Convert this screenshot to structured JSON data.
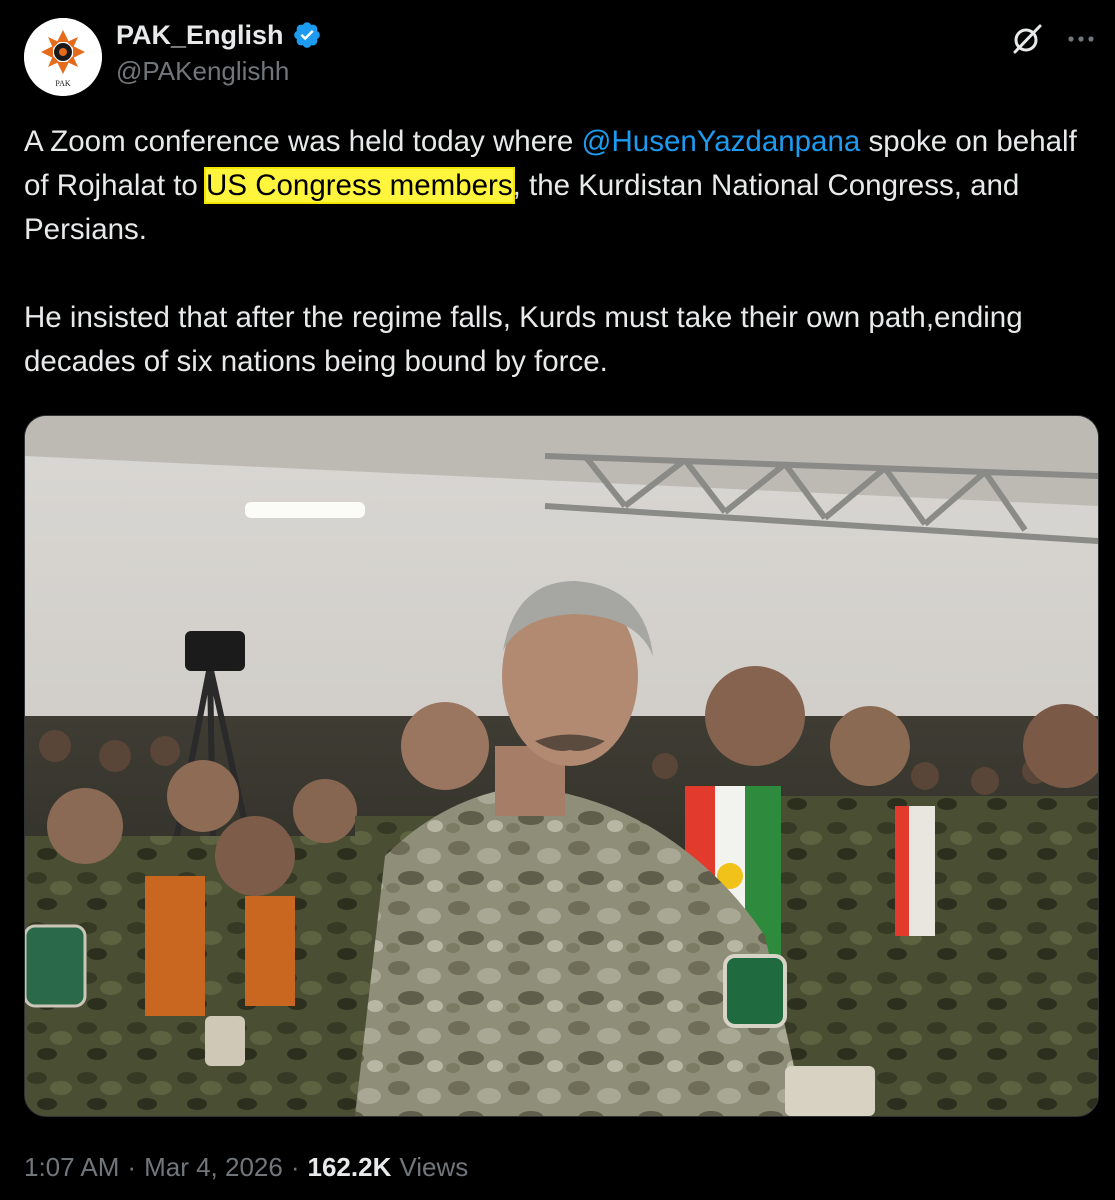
{
  "author": {
    "display_name": "PAK_English",
    "handle": "@PAKenglishh",
    "avatar_label": "PAK",
    "verified_icon": "verified-badge-icon"
  },
  "actions": {
    "grok_icon": "grok-icon",
    "more_icon": "more-options-icon"
  },
  "tweet": {
    "p1_a": "A Zoom conference was held today where ",
    "mention": "@HusenYazdanpana",
    "p1_b": " spoke on behalf of Rojhalat to ",
    "highlight": "US Congress members",
    "p1_c": ", the Kurdistan National Congress, and Persians.",
    "p2": "He insisted that after the regime falls, Kurds must take their own path,ending decades of six nations being bound by force."
  },
  "media": {
    "type": "photo"
  },
  "footer": {
    "time": "1:07 AM",
    "sep1": "·",
    "date": "Mar 4, 2026",
    "sep2": "·",
    "views_count": "162.2K",
    "views_label": "Views"
  },
  "colors": {
    "background": "#000000",
    "text": "#e7e9ea",
    "secondary": "#71767b",
    "link": "#1d9bf0",
    "highlight": "#fff53d"
  }
}
